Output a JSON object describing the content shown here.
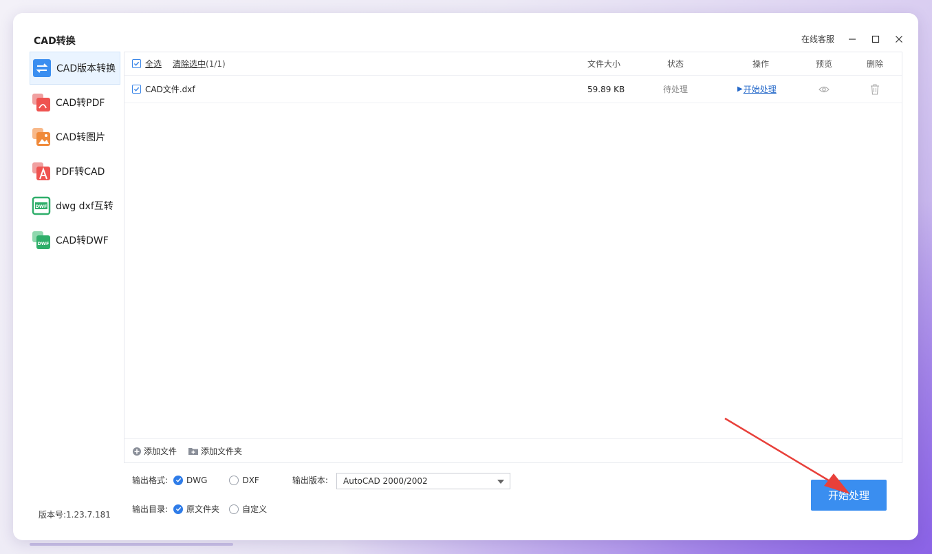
{
  "app": {
    "title": "CAD转换"
  },
  "titlebar": {
    "online_service": "在线客服",
    "minimize": "—",
    "maximize": "☐",
    "close": "✕"
  },
  "sidebar": {
    "items": [
      {
        "label": "CAD版本转换",
        "icon": "version-convert-icon",
        "color": "#3a8ef0",
        "active": true
      },
      {
        "label": "CAD转PDF",
        "icon": "pdf-icon",
        "color": "#ef5350"
      },
      {
        "label": "CAD转图片",
        "icon": "image-icon",
        "color": "#f08a3a"
      },
      {
        "label": "PDF转CAD",
        "icon": "pdf-to-cad-icon",
        "color": "#ef5350"
      },
      {
        "label": "dwg dxf互转",
        "icon": "dwf-swap-icon",
        "color": "#2fae6a"
      },
      {
        "label": "CAD转DWF",
        "icon": "dwf-icon",
        "color": "#2fae6a"
      }
    ],
    "version": "版本号:1.23.7.181"
  },
  "table": {
    "select_all": "全选",
    "clear_selection": "清除选中",
    "selection_count": "(1/1)",
    "columns": {
      "size": "文件大小",
      "status": "状态",
      "action": "操作",
      "preview": "预览",
      "delete": "删除"
    },
    "rows": [
      {
        "name": "CAD文件.dxf",
        "size": "59.89 KB",
        "status": "待处理",
        "action": "开始处理",
        "checked": true
      }
    ]
  },
  "add_bar": {
    "add_file": "添加文件",
    "add_folder": "添加文件夹"
  },
  "settings": {
    "format_label": "输出格式:",
    "format_options": [
      {
        "label": "DWG",
        "selected": true
      },
      {
        "label": "DXF",
        "selected": false
      }
    ],
    "version_label": "输出版本:",
    "version_value": "AutoCAD 2000/2002",
    "dir_label": "输出目录:",
    "dir_options": [
      {
        "label": "原文件夹",
        "selected": true
      },
      {
        "label": "自定义",
        "selected": false
      }
    ]
  },
  "start_button": "开始处理",
  "colors": {
    "accent": "#3a8ef0",
    "annotation_arrow": "#e8403a"
  }
}
